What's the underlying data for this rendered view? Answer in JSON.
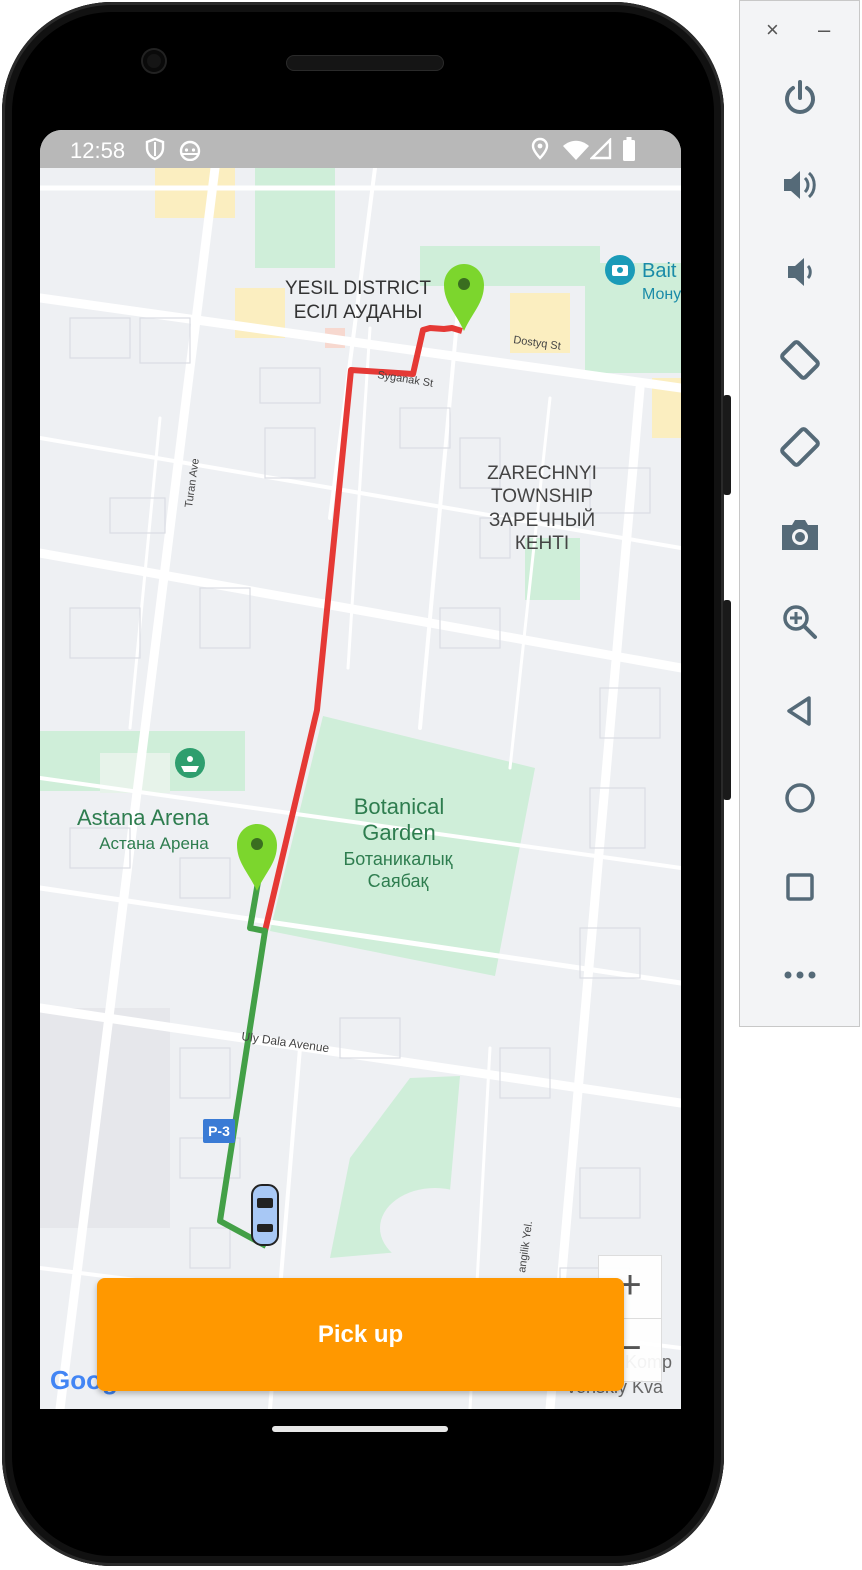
{
  "status_bar": {
    "time": "12:58",
    "icons": [
      "shield-icon",
      "android-icon",
      "location-icon",
      "wifi-icon",
      "signal-icon",
      "battery-icon"
    ]
  },
  "map": {
    "labels": {
      "yesil_en": "YESIL DISTRICT",
      "yesil_kz": "ЕСІЛ АУДАНЫ",
      "zarechnyi_1": "ZARECHNYI",
      "zarechnyi_2": "TOWNSHIP",
      "zarechnyi_3": "ЗАРЕЧНЫЙ",
      "zarechnyi_4": "КЕНТІ",
      "arena_en": "Astana Arena",
      "arena_ru": "Астана Арена",
      "botanical_1": "Botanical",
      "botanical_2": "Garden",
      "botanical_kz1": "Ботаникалық",
      "botanical_kz2": "Саябақ",
      "baiterek_1": "Bait",
      "baiterek_2": "Мону",
      "dostyq": "Dostyq St",
      "syganak": "Syganak St",
      "turan": "Turan Ave",
      "uly_dala": "Uly Dala Avenue",
      "mangilik": "angilik Yel.",
      "road_badge": "P-3",
      "corner_1": "Komp",
      "corner_2": "venskiy Kva",
      "google": "Google"
    },
    "route_colors": {
      "red": "#e53935",
      "green": "#43a047"
    },
    "pin_color": "#7cd62d",
    "zoom_in": "+",
    "zoom_out": "−"
  },
  "pickup_button": {
    "label": "Pick up",
    "color": "#ff9800"
  },
  "emulator_panel": {
    "close": "×",
    "minimize": "–",
    "buttons": [
      "power-icon",
      "volume-up-icon",
      "volume-down-icon",
      "rotate-left-icon",
      "rotate-right-icon",
      "camera-icon",
      "zoom-icon",
      "back-icon",
      "home-icon",
      "overview-icon",
      "more-icon"
    ]
  }
}
